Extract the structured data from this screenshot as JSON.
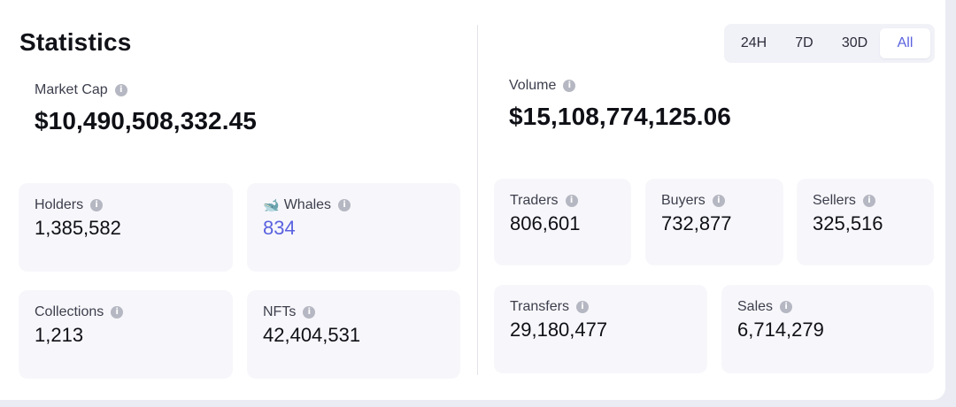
{
  "title": "Statistics",
  "time_ranges": [
    "24H",
    "7D",
    "30D",
    "All"
  ],
  "selected_range": "All",
  "market_cap": {
    "label": "Market Cap",
    "value": "$10,490,508,332.45"
  },
  "volume": {
    "label": "Volume",
    "value": "$15,108,774,125.06"
  },
  "left_cards": {
    "holders": {
      "label": "Holders",
      "value": "1,385,582"
    },
    "whales": {
      "label": "Whales",
      "value": "834",
      "icon": "whale-icon"
    },
    "collections": {
      "label": "Collections",
      "value": "1,213"
    },
    "nfts": {
      "label": "NFTs",
      "value": "42,404,531"
    }
  },
  "right_cards": {
    "traders": {
      "label": "Traders",
      "value": "806,601"
    },
    "buyers": {
      "label": "Buyers",
      "value": "732,877"
    },
    "sellers": {
      "label": "Sellers",
      "value": "325,516"
    },
    "transfers": {
      "label": "Transfers",
      "value": "29,180,477"
    },
    "sales": {
      "label": "Sales",
      "value": "6,714,279"
    }
  },
  "colors": {
    "accent": "#5a62e0",
    "card_bg": "#f7f7fb",
    "info_icon": "#b5b7c2"
  }
}
